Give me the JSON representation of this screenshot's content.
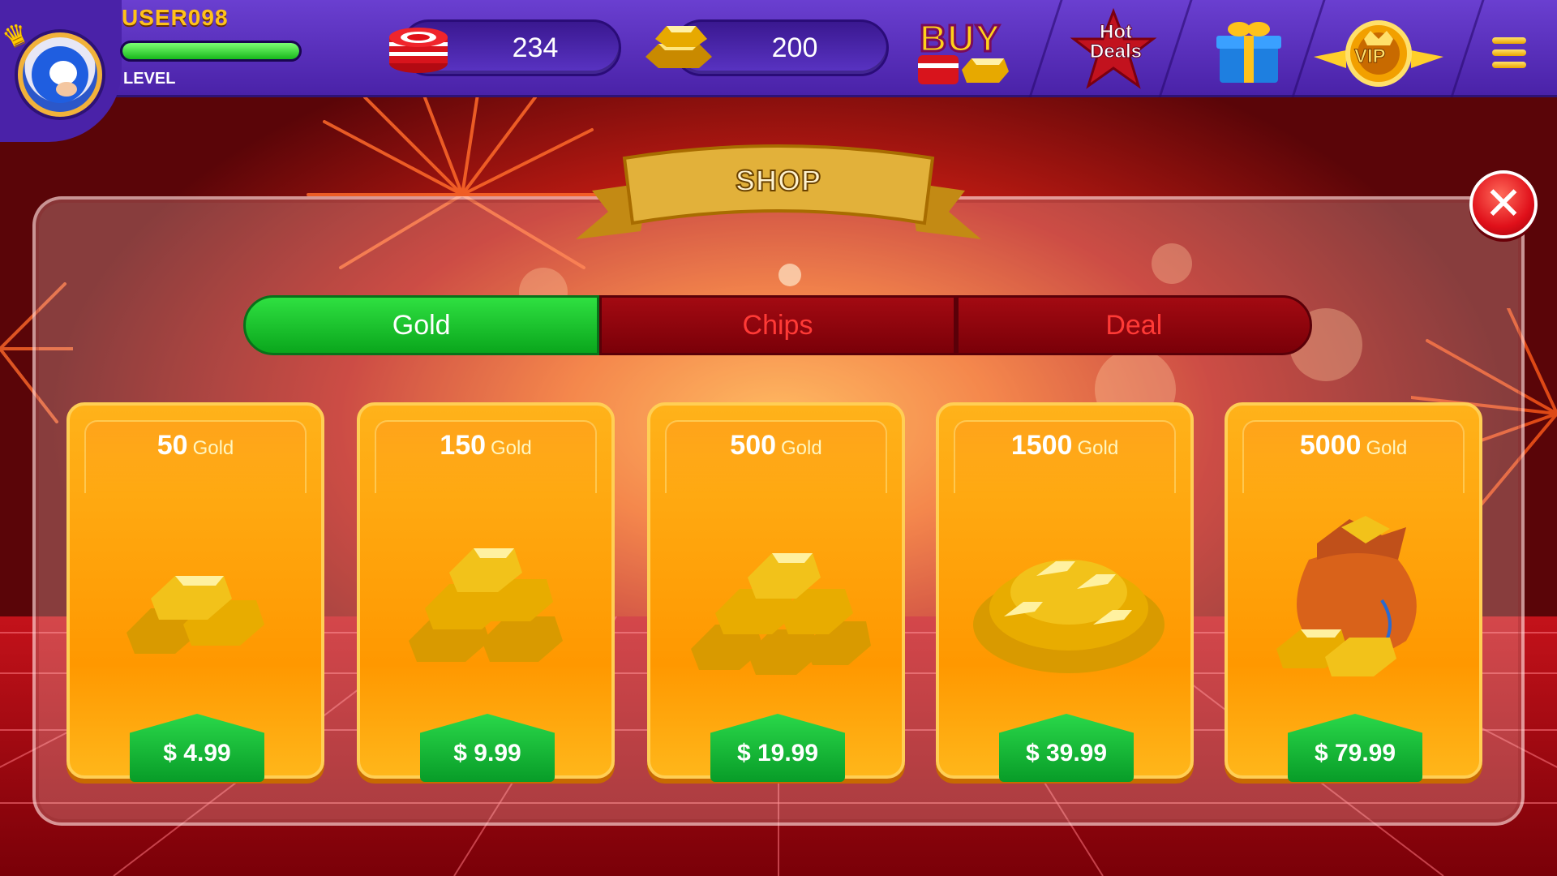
{
  "topbar": {
    "username": "USER098",
    "level_label": "LEVEL",
    "level_progress": 1.0,
    "chips_balance": "234",
    "gold_balance": "200",
    "buy_label": "BUY",
    "hot_deals_label_1": "Hot",
    "hot_deals_label_2": "Deals",
    "vip_label": "VIP"
  },
  "shop": {
    "title": "SHOP",
    "tabs": [
      {
        "label": "Gold",
        "active": true
      },
      {
        "label": "Chips",
        "active": false
      },
      {
        "label": "Deal",
        "active": false
      }
    ],
    "items": [
      {
        "amount": "50",
        "unit": "Gold",
        "price": "$ 4.99",
        "art": "small-gold-pile"
      },
      {
        "amount": "150",
        "unit": "Gold",
        "price": "$ 9.99",
        "art": "gold-bar-stack"
      },
      {
        "amount": "500",
        "unit": "Gold",
        "price": "$ 19.99",
        "art": "gold-bar-pyramid"
      },
      {
        "amount": "1500",
        "unit": "Gold",
        "price": "$ 39.99",
        "art": "large-gold-pile"
      },
      {
        "amount": "5000",
        "unit": "Gold",
        "price": "$ 79.99",
        "art": "gold-sack"
      }
    ]
  },
  "colors": {
    "topbar": "#5a2fc0",
    "active_tab": "#12c22a",
    "inactive_tab": "#8a0a10",
    "inactive_tab_text": "#ff3a36",
    "card": "#ffa000",
    "price_button": "#14b83a",
    "username": "#ffc21a"
  }
}
